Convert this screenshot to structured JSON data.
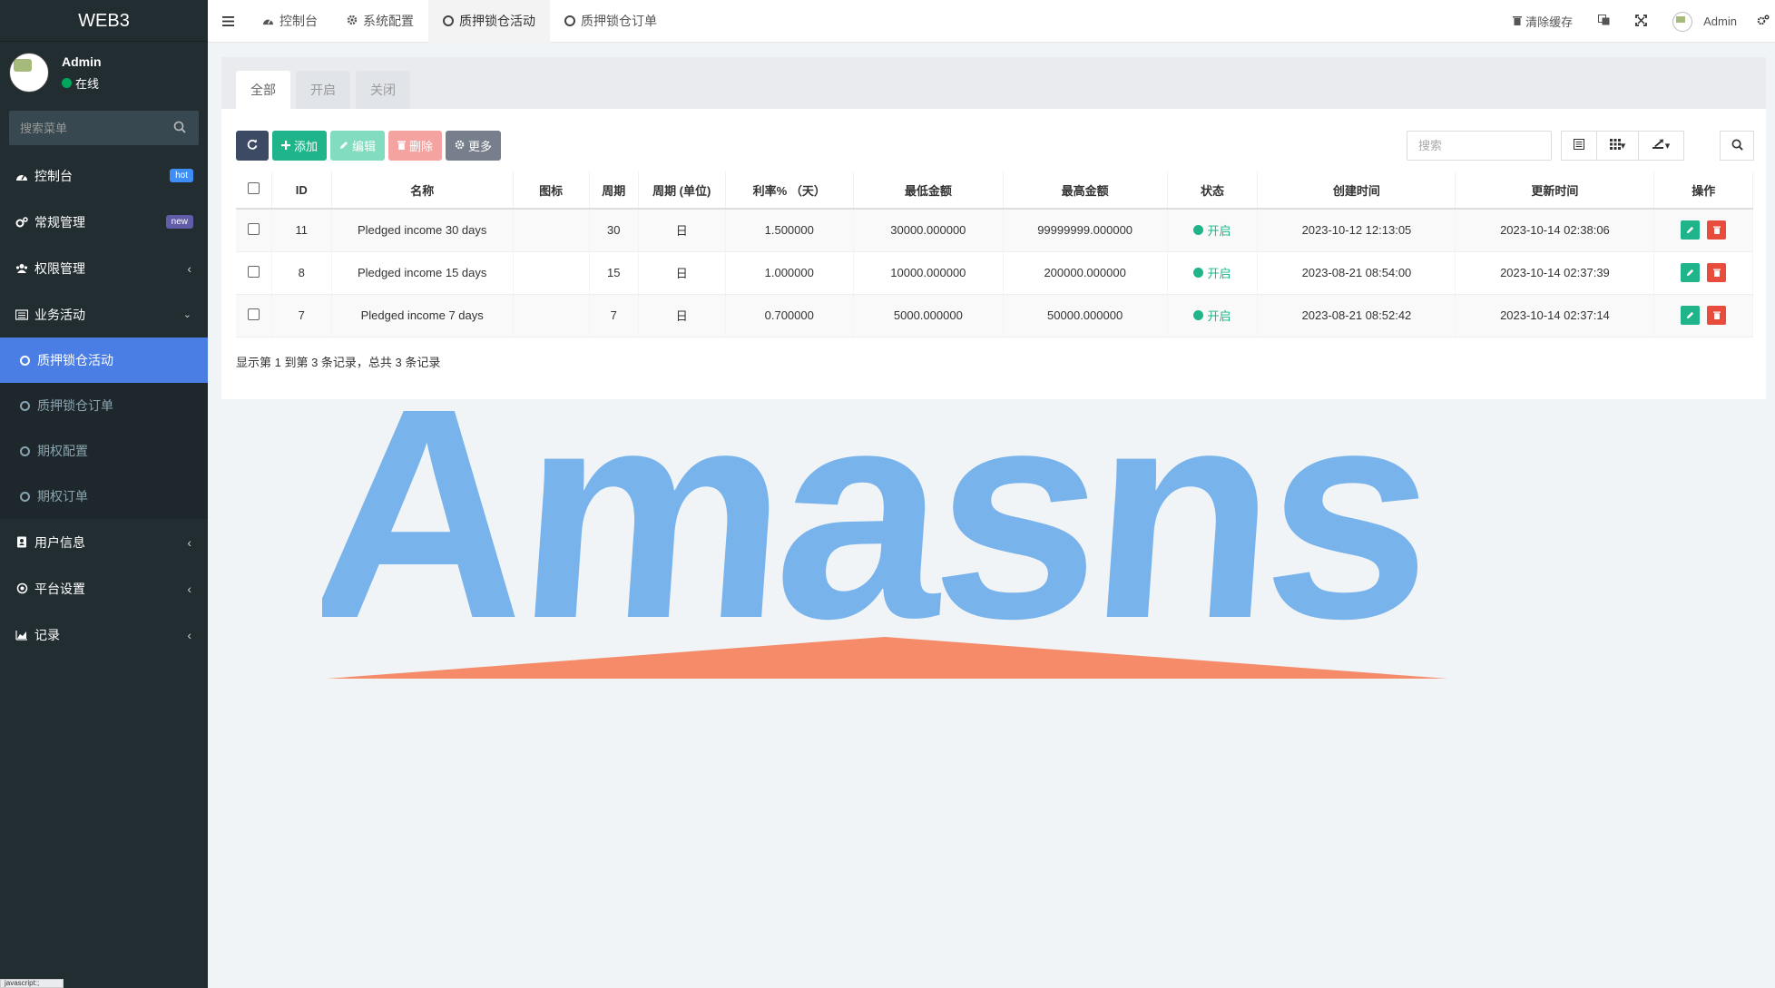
{
  "app": {
    "title": "WEB3"
  },
  "user": {
    "name": "Admin",
    "status": "在线"
  },
  "sidebar": {
    "search_placeholder": "搜索菜单",
    "items": [
      {
        "label": "控制台",
        "icon": "dashboard-icon",
        "badge": "hot"
      },
      {
        "label": "常规管理",
        "icon": "cogs-icon",
        "badge": "new"
      },
      {
        "label": "权限管理",
        "icon": "group-icon"
      },
      {
        "label": "业务活动",
        "icon": "list-alt-icon"
      },
      {
        "label": "用户信息",
        "icon": "address-book-icon"
      },
      {
        "label": "平台设置",
        "icon": "dot-circle-icon"
      },
      {
        "label": "记录",
        "icon": "area-chart-icon"
      }
    ],
    "submenu": [
      {
        "label": "质押锁仓活动",
        "active": true
      },
      {
        "label": "质押锁仓订单"
      },
      {
        "label": "期权配置"
      },
      {
        "label": "期权订单"
      }
    ]
  },
  "topnav": {
    "tabs": [
      {
        "label": "控制台"
      },
      {
        "label": "系统配置"
      },
      {
        "label": "质押锁仓活动",
        "active": true
      },
      {
        "label": "质押锁仓订单"
      }
    ],
    "clear_cache": "清除缓存",
    "admin_name": "Admin"
  },
  "panel": {
    "tabs": [
      "全部",
      "开启",
      "关闭"
    ],
    "toolbar": {
      "add": "添加",
      "edit": "编辑",
      "delete": "删除",
      "more": "更多"
    },
    "search_placeholder": "搜索",
    "columns": [
      "ID",
      "名称",
      "图标",
      "周期",
      "周期 (单位)",
      "利率% （天）",
      "最低金额",
      "最高金额",
      "状态",
      "创建时间",
      "更新时间",
      "操作"
    ],
    "rows": [
      {
        "id": "11",
        "name": "Pledged income 30 days",
        "icon": "",
        "period": "30",
        "unit": "日",
        "rate": "1.500000",
        "min": "30000.000000",
        "max": "99999999.000000",
        "status": "开启",
        "created": "2023-10-12 12:13:05",
        "updated": "2023-10-14 02:38:06"
      },
      {
        "id": "8",
        "name": "Pledged income 15 days",
        "icon": "",
        "period": "15",
        "unit": "日",
        "rate": "1.000000",
        "min": "10000.000000",
        "max": "200000.000000",
        "status": "开启",
        "created": "2023-08-21 08:54:00",
        "updated": "2023-10-14 02:37:39"
      },
      {
        "id": "7",
        "name": "Pledged income 7 days",
        "icon": "",
        "period": "7",
        "unit": "日",
        "rate": "0.700000",
        "min": "5000.000000",
        "max": "50000.000000",
        "status": "开启",
        "created": "2023-08-21 08:52:42",
        "updated": "2023-10-14 02:37:14"
      }
    ],
    "pagination_info": "显示第 1 到第 3 条记录，总共 3 条记录"
  },
  "watermark": {
    "text": "Amasns",
    "color": "#4a9ae8",
    "accent": "#f5805a"
  },
  "statusbar": {
    "text": "javascript:;"
  },
  "colors": {
    "sidebar_bg": "#222d32",
    "active_menu": "#4a7ee5",
    "success": "#1fb489",
    "danger": "#e84c3d"
  }
}
